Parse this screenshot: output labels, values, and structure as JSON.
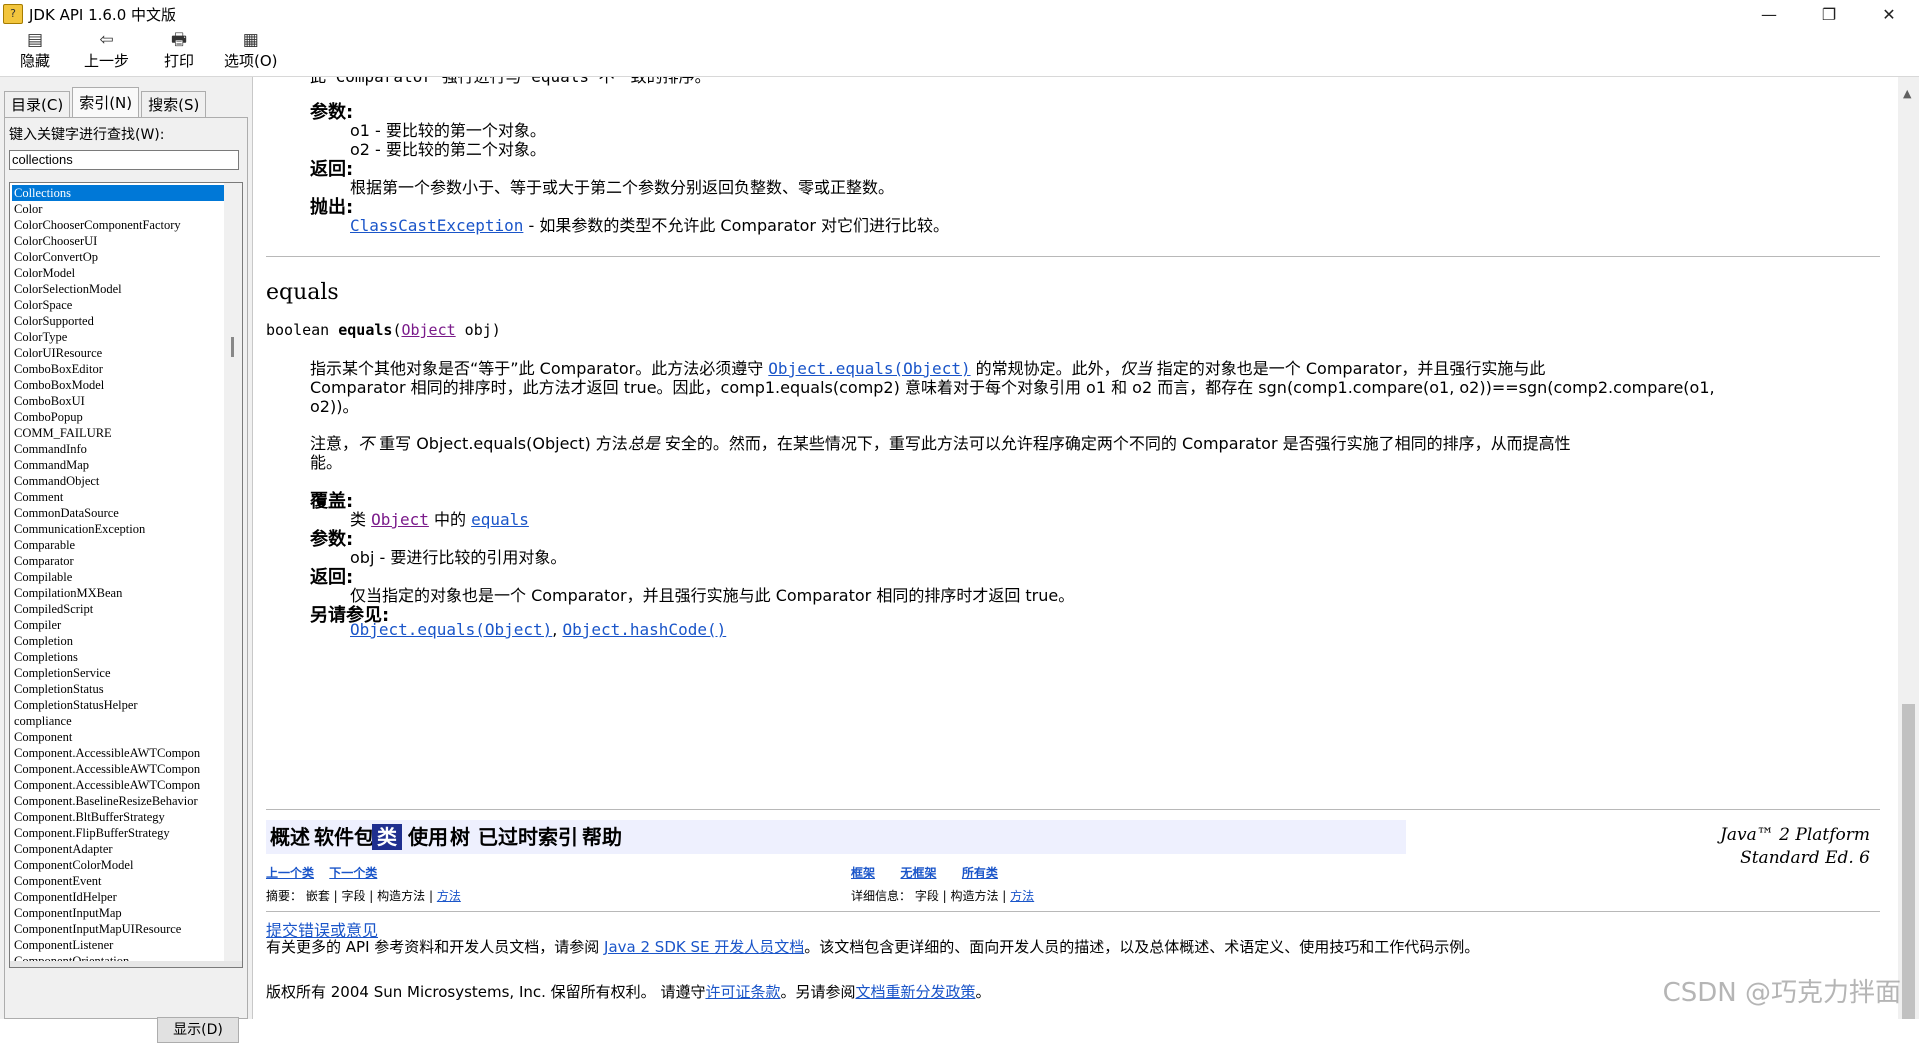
{
  "window": {
    "title": "JDK API 1.6.0 中文版"
  },
  "toolbar": {
    "hide": "隐藏",
    "back": "上一步",
    "print": "打印",
    "options": "选项(O)"
  },
  "tabs": [
    "目录(C)",
    "索引(N)",
    "搜索(S)"
  ],
  "index": {
    "label": "键入关键字进行查找(W):",
    "search_value": "collections",
    "selected": "Collections",
    "items": [
      "Collections",
      "Color",
      "ColorChooserComponentFactory",
      "ColorChooserUI",
      "ColorConvertOp",
      "ColorModel",
      "ColorSelectionModel",
      "ColorSpace",
      "ColorSupported",
      "ColorType",
      "ColorUIResource",
      "ComboBoxEditor",
      "ComboBoxModel",
      "ComboBoxUI",
      "ComboPopup",
      "COMM_FAILURE",
      "CommandInfo",
      "CommandMap",
      "CommandObject",
      "Comment",
      "CommonDataSource",
      "CommunicationException",
      "Comparable",
      "Comparator",
      "Compilable",
      "CompilationMXBean",
      "CompiledScript",
      "Compiler",
      "Completion",
      "Completions",
      "CompletionService",
      "CompletionStatus",
      "CompletionStatusHelper",
      "compliance",
      "Component",
      "Component.AccessibleAWTCompon",
      "Component.AccessibleAWTCompon",
      "Component.AccessibleAWTCompon",
      "Component.BaselineResizeBehavior",
      "Component.BltBufferStrategy",
      "Component.FlipBufferStrategy",
      "ComponentAdapter",
      "ComponentColorModel",
      "ComponentEvent",
      "ComponentIdHelper",
      "ComponentInputMap",
      "ComponentInputMapUIResource",
      "ComponentListener",
      "ComponentOrientation"
    ],
    "display_button": "显示(D)"
  },
  "doc": {
    "top_line": "此 Comparator 强行进行与 equals 不一致的排序。”",
    "params_label": "参数:",
    "param_o1": "o1 - 要比较的第一个对象。",
    "param_o2": "o2 - 要比较的第二个对象。",
    "returns_label": "返回:",
    "returns_text": "根据第一个参数小于、等于或大于第二个参数分别返回负整数、零或正整数。",
    "throws_label": "抛出:",
    "throws_link": "ClassCastException",
    "throws_text": " - 如果参数的类型不允许此 Comparator 对它们进行比较。",
    "method_heading": "equals",
    "sig_prefix": "boolean ",
    "sig_name": "equals",
    "sig_open": "(",
    "sig_type": "Object",
    "sig_rest": " obj)",
    "p1_a": "指示某个其他对象是否“等于”此 Comparator。此方法必须遵守 ",
    "p1_link": "Object.equals(Object)",
    "p1_b": " 的常规协定。此外，",
    "p1_em": "仅当",
    "p1_c": " 指定的对象也是一个 Comparator，并且强行实施与此",
    "p1_line2": "Comparator 相同的排序时，此方法才返回 true。因此，comp1.equals(comp2) 意味着对于每个对象引用 o1 和 o2 而言，都存在 sgn(comp1.compare(o1, o2))==sgn(comp2.compare(o1,",
    "p1_line3": "o2))。",
    "p2_a": "注意，",
    "p2_em1": "不",
    "p2_b": " 重写 Object.equals(Object) 方法",
    "p2_em2": "总是",
    "p2_c": " 安全的。然而，在某些情况下，重写此方法可以允许程序确定两个不同的 Comparator 是否强行实施了相同的排序，从而提高性",
    "p2_line2": "能。",
    "overrides_label": "覆盖:",
    "overrides_a": "类 ",
    "overrides_link1": "Object",
    "overrides_b": " 中的 ",
    "overrides_link2": "equals",
    "params2_label": "参数:",
    "param_obj": "obj - 要进行比较的引用对象。",
    "returns2_label": "返回:",
    "returns2_text": "仅当指定的对象也是一个 Comparator，并且强行实施与此 Comparator 相同的排序时才返回 true。",
    "see_label": "另请参见:",
    "see_link1": "Object.equals(Object)",
    "see_sep": ", ",
    "see_link2": "Object.hashCode()"
  },
  "nav": {
    "items": [
      "概述",
      "软件包",
      "类",
      "使用",
      "树",
      "已过时",
      "索引",
      "帮助"
    ],
    "active": "类",
    "platform_line1": "Java™ 2 Platform",
    "platform_line2": "Standard Ed. 6",
    "prev_class": "上一个类",
    "next_class": "下一个类",
    "frames": "框架",
    "no_frames": "无框架",
    "all_classes": "所有类",
    "summary_text": "摘要： 嵌套 | 字段 | 构造方法 | ",
    "summary_link": "方法",
    "detail_text": "详细信息： 字段 | 构造方法 | ",
    "detail_link": "方法"
  },
  "footer": {
    "bug_link": "提交错误或意见",
    "more_a": "有关更多的 API 参考资料和开发人员文档，请参阅 ",
    "more_link": "Java 2 SDK SE 开发人员文档",
    "more_b": "。该文档包含更详细的、面向开发人员的描述，以及总体概述、术语定义、使用技巧和工作代码示例。",
    "copy_a": "版权所有 2004 Sun Microsystems, Inc. 保留所有权利。 请遵守",
    "copy_link1": "许可证条款",
    "copy_b": "。另请参阅",
    "copy_link2": "文档重新分发政策",
    "copy_c": "。"
  },
  "watermark": "CSDN @巧克力拌面"
}
